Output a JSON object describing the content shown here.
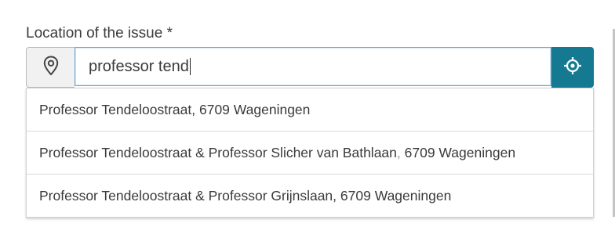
{
  "form": {
    "location_label": "Location of the issue *",
    "search_value": "professor tend"
  },
  "icons": {
    "left_addon": "map-pin-icon",
    "right_addon": "locate-crosshair-icon"
  },
  "colors": {
    "locate_button_bg": "#157a91",
    "input_focus_border": "#6aa7d6"
  },
  "suggestions": [
    {
      "street": "Professor Tendeloostraat",
      "sep": ", ",
      "place": "6709 Wageningen"
    },
    {
      "street": "Professor Tendeloostraat & Professor Slicher van Bathlaan",
      "sep": ", ",
      "place": "6709 Wageningen"
    },
    {
      "street": "Professor Tendeloostraat & Professor Grijnslaan",
      "sep": ", ",
      "place": "6709 Wageningen"
    }
  ]
}
